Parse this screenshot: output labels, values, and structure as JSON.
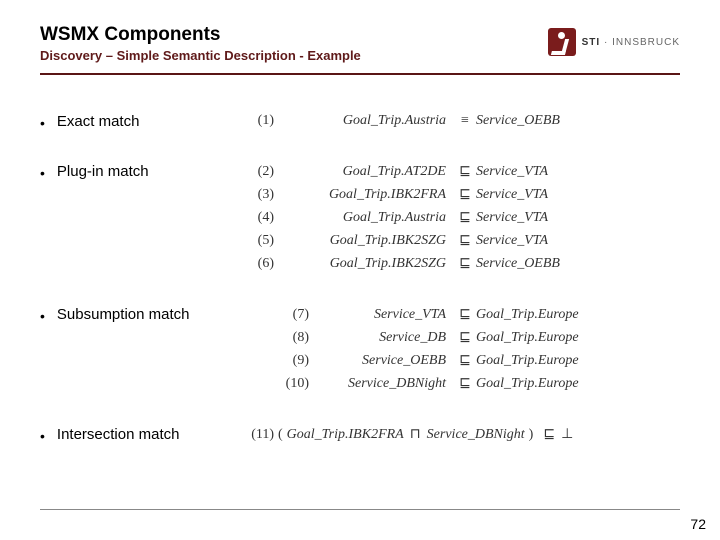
{
  "header": {
    "title": "WSMX Components",
    "subtitle": "Discovery – Simple Semantic Description - Example",
    "logo_brand": "STI",
    "logo_sep": " · ",
    "logo_place": "INNSBRUCK"
  },
  "bullets": {
    "exact": "Exact match",
    "plugin": "Plug-in match",
    "subsumption": "Subsumption match",
    "intersection": "Intersection match"
  },
  "formulas": {
    "f1": {
      "n": "(1)",
      "lhs": "Goal_Trip.Austria",
      "op": "≡",
      "rhs": "Service_OEBB"
    },
    "f2": {
      "n": "(2)",
      "lhs": "Goal_Trip.AT2DE",
      "op": "⊑",
      "rhs": "Service_VTA"
    },
    "f3": {
      "n": "(3)",
      "lhs": "Goal_Trip.IBK2FRA",
      "op": "⊑",
      "rhs": "Service_VTA"
    },
    "f4": {
      "n": "(4)",
      "lhs": "Goal_Trip.Austria",
      "op": "⊑",
      "rhs": "Service_VTA"
    },
    "f5": {
      "n": "(5)",
      "lhs": "Goal_Trip.IBK2SZG",
      "op": "⊑",
      "rhs": "Service_VTA"
    },
    "f6": {
      "n": "(6)",
      "lhs": "Goal_Trip.IBK2SZG",
      "op": "⊑",
      "rhs": "Service_OEBB"
    },
    "f7": {
      "n": "(7)",
      "lhs": "Service_VTA",
      "op": "⊑",
      "rhs": "Goal_Trip.Europe"
    },
    "f8": {
      "n": "(8)",
      "lhs": "Service_DB",
      "op": "⊑",
      "rhs": "Goal_Trip.Europe"
    },
    "f9": {
      "n": "(9)",
      "lhs": "Service_OEBB",
      "op": "⊑",
      "rhs": "Goal_Trip.Europe"
    },
    "f10": {
      "n": "(10)",
      "lhs": "Service_DBNight",
      "op": "⊑",
      "rhs": "Goal_Trip.Europe"
    },
    "f11": {
      "n": "(11)",
      "open": "(",
      "a": "Goal_Trip.IBK2FRA",
      "meet": "⊓",
      "b": "Service_DBNight",
      "close": ")",
      "op": "⊑",
      "bot": "⊥"
    }
  },
  "page": "72"
}
